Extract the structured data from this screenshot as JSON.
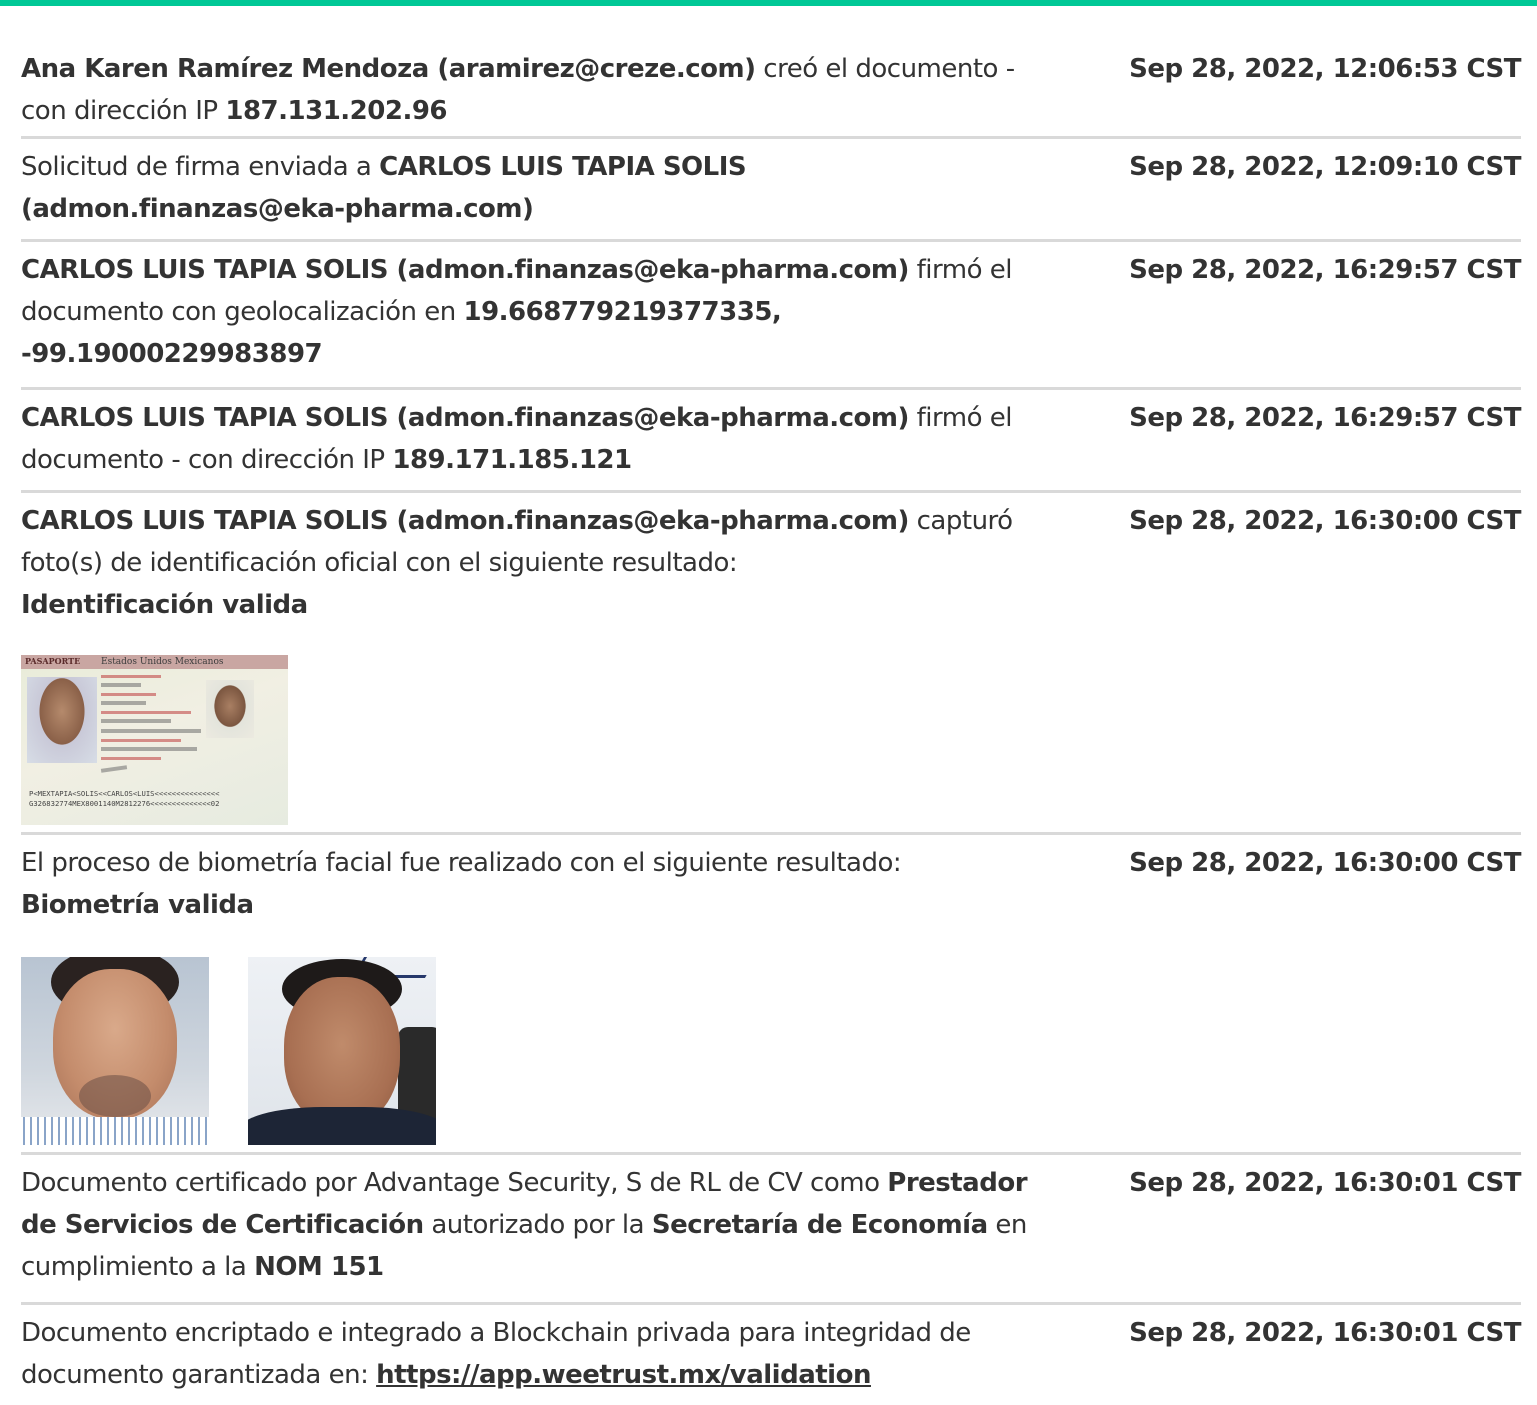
{
  "events": [
    {
      "segments": [
        {
          "t": "Ana Karen Ramírez Mendoza (aramirez@creze.com)",
          "b": true
        },
        {
          "t": " creó el documento - con dirección IP ",
          "b": false
        },
        {
          "t": "187.131.202.96",
          "b": true
        }
      ],
      "time": "Sep 28, 2022, 12:06:53 CST"
    },
    {
      "segments": [
        {
          "t": "Solicitud de firma enviada a ",
          "b": false
        },
        {
          "t": "CARLOS LUIS TAPIA SOLIS (admon.finanzas@eka-pharma.com)",
          "b": true
        }
      ],
      "time": "Sep 28, 2022, 12:09:10 CST"
    },
    {
      "segments": [
        {
          "t": "CARLOS LUIS TAPIA SOLIS (admon.finanzas@eka-pharma.com)",
          "b": true
        },
        {
          "t": " firmó el documento con geolocalización en ",
          "b": false
        },
        {
          "t": "19.668779219377335, -99.19000229983897",
          "b": true
        }
      ],
      "time": "Sep 28, 2022, 16:29:57 CST"
    },
    {
      "segments": [
        {
          "t": "CARLOS LUIS TAPIA SOLIS (admon.finanzas@eka-pharma.com)",
          "b": true
        },
        {
          "t": " firmó el documento - con dirección IP ",
          "b": false
        },
        {
          "t": "189.171.185.121",
          "b": true
        }
      ],
      "time": "Sep 28, 2022, 16:29:57 CST"
    },
    {
      "segments": [
        {
          "t": "CARLOS LUIS TAPIA SOLIS (admon.finanzas@eka-pharma.com)",
          "b": true
        },
        {
          "t": " capturó foto(s) de identificación oficial con el siguiente resultado: ",
          "b": false
        },
        {
          "t": "Identificación valida",
          "b": true,
          "block": true
        }
      ],
      "time": "Sep 28, 2022, 16:30:00 CST",
      "images": [
        "passport"
      ],
      "passport": {
        "header": "PASAPORTE",
        "country": "Estados Unidos Mexicanos",
        "mrz1": "P<MEXTAPIA<SOLIS<<CARLOS<LUIS<<<<<<<<<<<<<<<",
        "mrz2": "G326832774MEX8001140M2812276<<<<<<<<<<<<<<02"
      }
    },
    {
      "segments": [
        {
          "t": "El proceso de biometría facial fue realizado con el siguiente resultado: ",
          "b": false
        },
        {
          "t": "Biometría valida",
          "b": true,
          "block": true
        }
      ],
      "time": "Sep 28, 2022, 16:30:00 CST",
      "images": [
        "face-id",
        "face-selfie"
      ]
    },
    {
      "segments": [
        {
          "t": "Documento certificado por Advantage Security, S de RL de CV como ",
          "b": false
        },
        {
          "t": "Prestador de Servicios de Certificación",
          "b": true
        },
        {
          "t": " autorizado por la ",
          "b": false
        },
        {
          "t": "Secretaría de Economía",
          "b": true
        },
        {
          "t": " en cumplimiento a la ",
          "b": false
        },
        {
          "t": "NOM 151",
          "b": true
        }
      ],
      "time": "Sep 28, 2022, 16:30:01 CST"
    },
    {
      "segments": [
        {
          "t": "Documento encriptado e integrado a Blockchain privada para integridad de documento garantizada en: ",
          "b": false
        },
        {
          "t": "https://app.weetrust.mx/validation",
          "b": true,
          "link": true
        }
      ],
      "time": "Sep 28, 2022, 16:30:01 CST"
    }
  ],
  "colors": {
    "accent": "#00c896",
    "divider": "#d9d9d9",
    "text": "#333333"
  }
}
